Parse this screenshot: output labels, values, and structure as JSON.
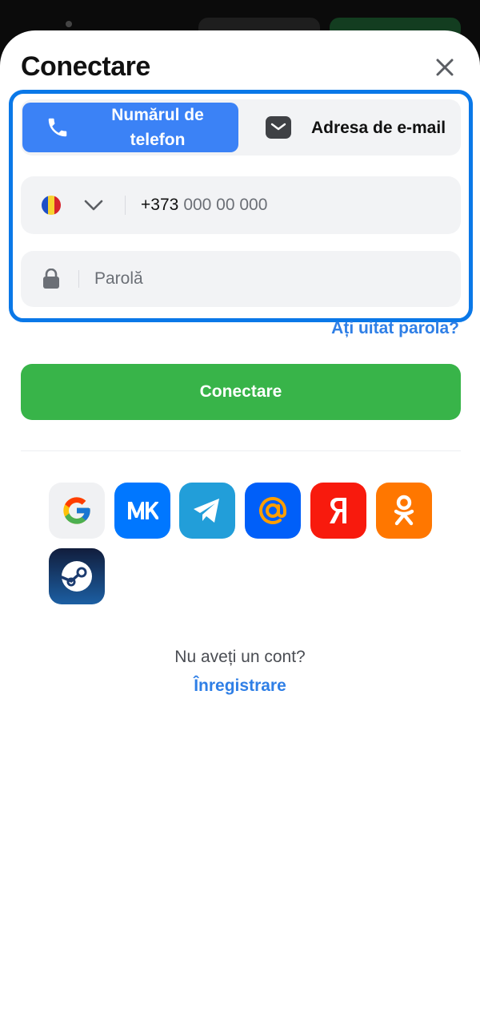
{
  "header": {
    "title": "Conectare",
    "close_icon": "close-icon"
  },
  "login_method_tabs": [
    {
      "label": "Numărul de telefon",
      "icon": "phone-icon",
      "selected": true
    },
    {
      "label": "Adresa de e-mail",
      "icon": "mail-icon",
      "selected": false
    }
  ],
  "phone_field": {
    "country_flag": "moldova-flag-icon",
    "country_code": "+373",
    "placeholder": "000 00 000"
  },
  "password_field": {
    "placeholder": "Parolă",
    "value": ""
  },
  "forgot_password_link": "Ați uitat parola?",
  "submit_button": "Conectare",
  "social_logins": [
    {
      "name": "google",
      "icon": "google-icon"
    },
    {
      "name": "vk",
      "icon": "vk-icon"
    },
    {
      "name": "telegram",
      "icon": "telegram-icon"
    },
    {
      "name": "mail-ru",
      "icon": "mail-at-icon"
    },
    {
      "name": "yandex",
      "icon": "yandex-icon"
    },
    {
      "name": "odnoklassniki",
      "icon": "odnoklassniki-icon"
    },
    {
      "name": "steam",
      "icon": "steam-icon"
    }
  ],
  "signup": {
    "prompt": "Nu aveți un cont?",
    "link": "Înregistrare"
  },
  "colors": {
    "accent": "#3b82f6",
    "focus_border": "#0a78e8",
    "link": "#2f7fe6",
    "primary_button": "#38b449",
    "field_background": "#f2f3f5"
  }
}
